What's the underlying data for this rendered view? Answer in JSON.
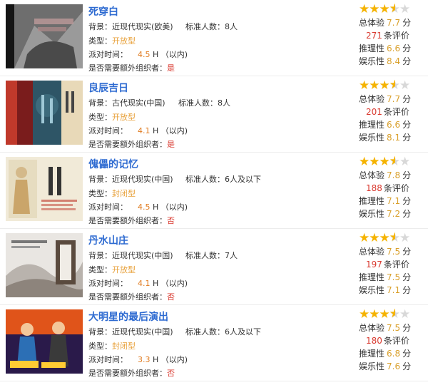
{
  "labels": {
    "background": "背景：",
    "players": "标准人数：",
    "type": "类型：",
    "time": "派对时间：",
    "time_unit": "H （以内)",
    "organizer": "是否需要额外组织者：",
    "overall": "总体验",
    "reviews": "条评价",
    "reasoning": "推理性",
    "fun": "娱乐性",
    "score_unit": "分"
  },
  "icons": {
    "star": "star-icon"
  },
  "colors": {
    "title": "#2e6bd1",
    "accent_orange": "#e8a23c",
    "accent_red": "#d9392f",
    "star": "#f5b300"
  },
  "games": [
    {
      "title": "死穿白",
      "background": "近现代现实(欧美)",
      "players": "8人",
      "type": "开放型",
      "time": "4.5",
      "organizer": "是",
      "rating": 3.5,
      "overall": "7.7",
      "reviews": "271",
      "reasoning": "6.6",
      "fun": "8.4"
    },
    {
      "title": "良辰吉日",
      "background": "古代现实(中国)",
      "players": "8人",
      "type": "开放型",
      "time": "4.1",
      "organizer": "是",
      "rating": 3.5,
      "overall": "7.7",
      "reviews": "201",
      "reasoning": "6.6",
      "fun": "8.1"
    },
    {
      "title": "傀儡的记忆",
      "background": "近现代现实(中国)",
      "players": "6人及以下",
      "type": "封闭型",
      "time": "4.5",
      "organizer": "否",
      "rating": 3.5,
      "overall": "7.8",
      "reviews": "188",
      "reasoning": "7.1",
      "fun": "7.2"
    },
    {
      "title": "丹水山庄",
      "background": "近现代现实(中国)",
      "players": "7人",
      "type": "开放型",
      "time": "4.1",
      "organizer": "否",
      "rating": 3.5,
      "overall": "7.5",
      "reviews": "197",
      "reasoning": "7.5",
      "fun": "7.1"
    },
    {
      "title": "大明星的最后演出",
      "background": "近现代现实(中国)",
      "players": "6人及以下",
      "type": "封闭型",
      "time": "3.3",
      "organizer": "否",
      "rating": 3.5,
      "overall": "7.5",
      "reviews": "180",
      "reasoning": "6.8",
      "fun": "7.6"
    }
  ]
}
